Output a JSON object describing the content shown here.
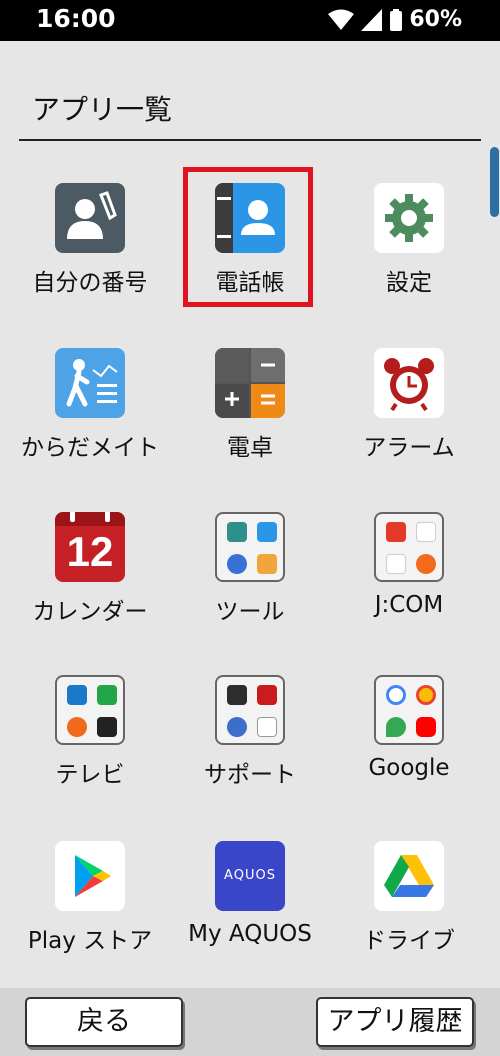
{
  "status": {
    "time": "16:00",
    "battery": "60%"
  },
  "title": "アプリ一覧",
  "apps": [
    {
      "label": "自分の番号",
      "icon": "contact-phone-icon"
    },
    {
      "label": "電話帳",
      "icon": "address-book-icon"
    },
    {
      "label": "設定",
      "icon": "gear-icon"
    },
    {
      "label": "からだメイト",
      "icon": "walking-person-icon"
    },
    {
      "label": "電卓",
      "icon": "calculator-icon"
    },
    {
      "label": "アラーム",
      "icon": "alarm-clock-icon"
    },
    {
      "label": "カレンダー",
      "icon": "calendar-icon",
      "day": "12"
    },
    {
      "label": "ツール",
      "icon": "tools-folder-icon"
    },
    {
      "label": "J:COM",
      "icon": "jcom-folder-icon"
    },
    {
      "label": "テレビ",
      "icon": "tv-folder-icon"
    },
    {
      "label": "サポート",
      "icon": "support-folder-icon"
    },
    {
      "label": "Google",
      "icon": "google-folder-icon"
    },
    {
      "label": "Play ストア",
      "icon": "play-store-icon"
    },
    {
      "label": "My AQUOS",
      "icon": "aquos-icon",
      "icon_text": "AQUOS"
    },
    {
      "label": "ドライブ",
      "icon": "google-drive-icon"
    }
  ],
  "buttons": {
    "back": "戻る",
    "history": "アプリ履歴"
  },
  "colors": {
    "highlight": "#e0141e",
    "scrollbar": "#2d6fa3"
  }
}
